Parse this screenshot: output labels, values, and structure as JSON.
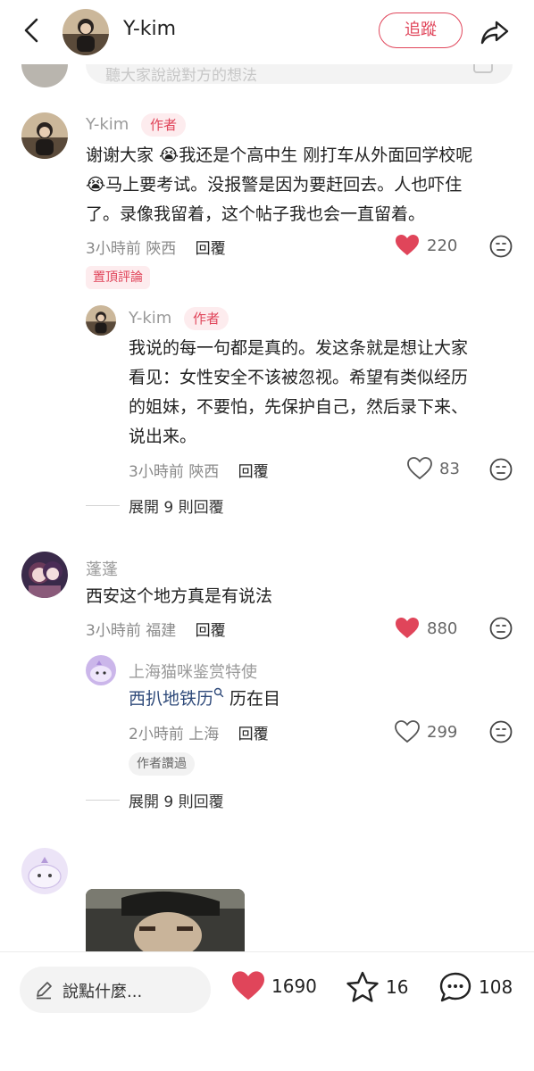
{
  "header": {
    "author_name": "Y-kim",
    "follow_label": "追蹤"
  },
  "previous": {
    "input_placeholder": "聽大家說說對方的想法"
  },
  "comments": [
    {
      "user": "Y-kim",
      "badge": "作者",
      "lines": [
        "谢谢大家 😭我还是个高中生 刚打车从外面回学校呢",
        "😭马上要考试。没报警是因为要赶回去。人也吓住",
        "了。录像我留着，这个帖子我也会一直留着。"
      ],
      "time": "3小時前",
      "location": "陝西",
      "reply_label": "回覆",
      "likes": "220",
      "liked": true,
      "pinned_label": "置頂評論",
      "replies": [
        {
          "user": "Y-kim",
          "badge": "作者",
          "lines": [
            "我说的每一句都是真的。发这条就是想让大家",
            "看见：女性安全不该被忽视。希望有类似经历",
            "的姐妹，不要怕，先保护自己，然后录下来、",
            "说出来。"
          ],
          "time": "3小時前",
          "location": "陝西",
          "reply_label": "回覆",
          "likes": "83",
          "liked": false
        }
      ],
      "expand_label": "展開 9 則回覆"
    },
    {
      "user": "蓬蓬",
      "lines": [
        "西安这个地方真是有说法"
      ],
      "time": "3小時前",
      "location": "福建",
      "reply_label": "回覆",
      "likes": "880",
      "liked": true,
      "replies": [
        {
          "user": "上海猫咪鉴赏特使",
          "link_text": "西扒地铁历",
          "rest_text": " 历在目",
          "time": "2小時前",
          "location": "上海",
          "reply_label": "回覆",
          "likes": "299",
          "liked": false,
          "read_badge": "作者讚過"
        }
      ],
      "expand_label": "展開 9 則回覆"
    }
  ],
  "bottom_bar": {
    "input_placeholder": "說點什麼...",
    "likes": "1690",
    "stars": "16",
    "comments": "108"
  },
  "colors": {
    "accent": "#e0455a",
    "link": "#2f4a7a",
    "muted": "#8a8a8a"
  }
}
